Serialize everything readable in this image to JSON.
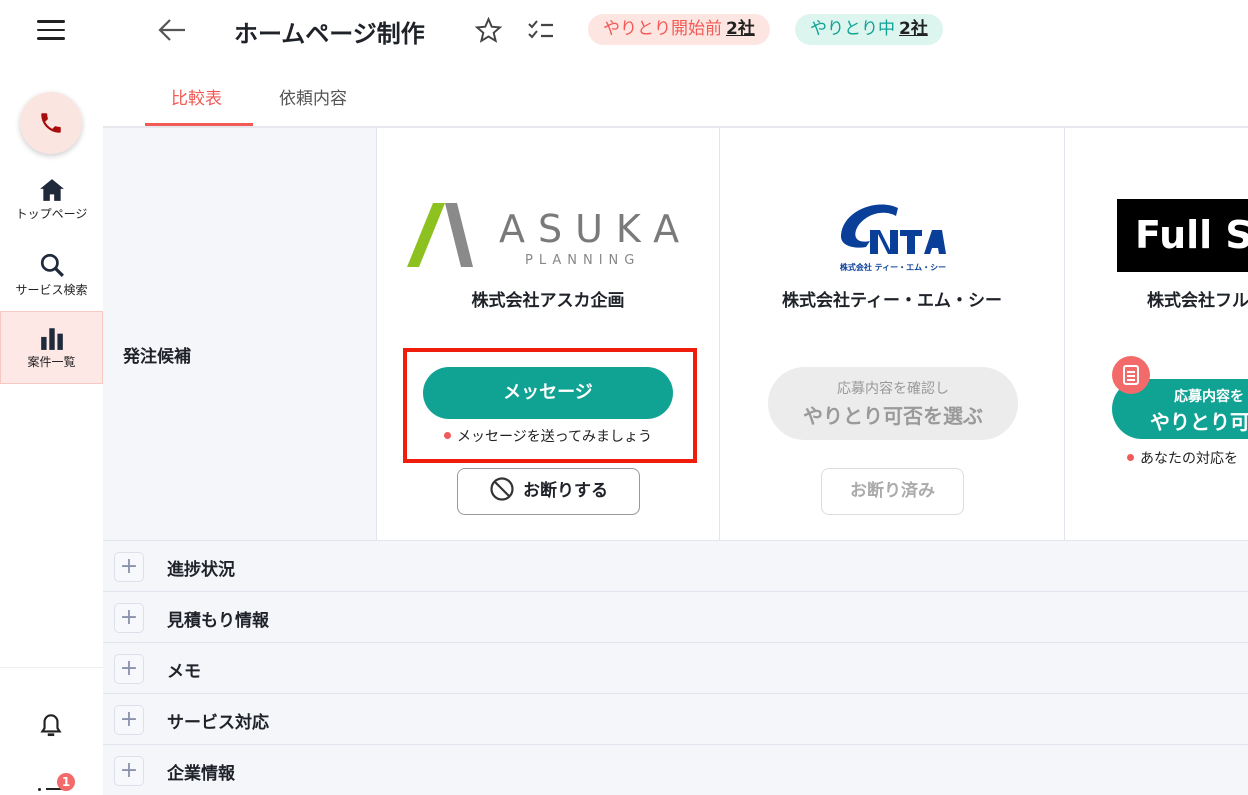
{
  "header": {
    "title": "ホームページ制作",
    "pill1": {
      "label": "やりとり開始前",
      "count": "2社"
    },
    "pill2": {
      "label": "やりとり中",
      "count": "2社"
    }
  },
  "sidebar": {
    "items": [
      {
        "label": "トップページ"
      },
      {
        "label": "サービス検索"
      },
      {
        "label": "案件一覧"
      }
    ],
    "badge": "1"
  },
  "tabs": [
    {
      "label": "比較表"
    },
    {
      "label": "依頼内容"
    }
  ],
  "row_label": "発注候補",
  "companies": [
    {
      "logo": "ASUKA",
      "logo_sub": "PLANNING",
      "name": "株式会社アスカ企画",
      "button": "メッセージ",
      "hint": "メッセージを送ってみましょう",
      "decline": "お断りする"
    },
    {
      "logo_sub": "株式会社 ティー・エム・シー",
      "name": "株式会社ティー・エム・シー",
      "button_small": "応募内容を確認し",
      "button_big": "やりとり可否を選ぶ",
      "decline": "お断り済み"
    },
    {
      "logo": "Full Sp",
      "name": "株式会社フル",
      "button_small": "応募内容を",
      "button_big": "やりとり可",
      "hint": "あなたの対応を"
    }
  ],
  "sections": [
    "進捗状況",
    "見積もり情報",
    "メモ",
    "サービス対応",
    "企業情報"
  ],
  "colors": {
    "accent": "#f25b55",
    "teal": "#10a394"
  }
}
